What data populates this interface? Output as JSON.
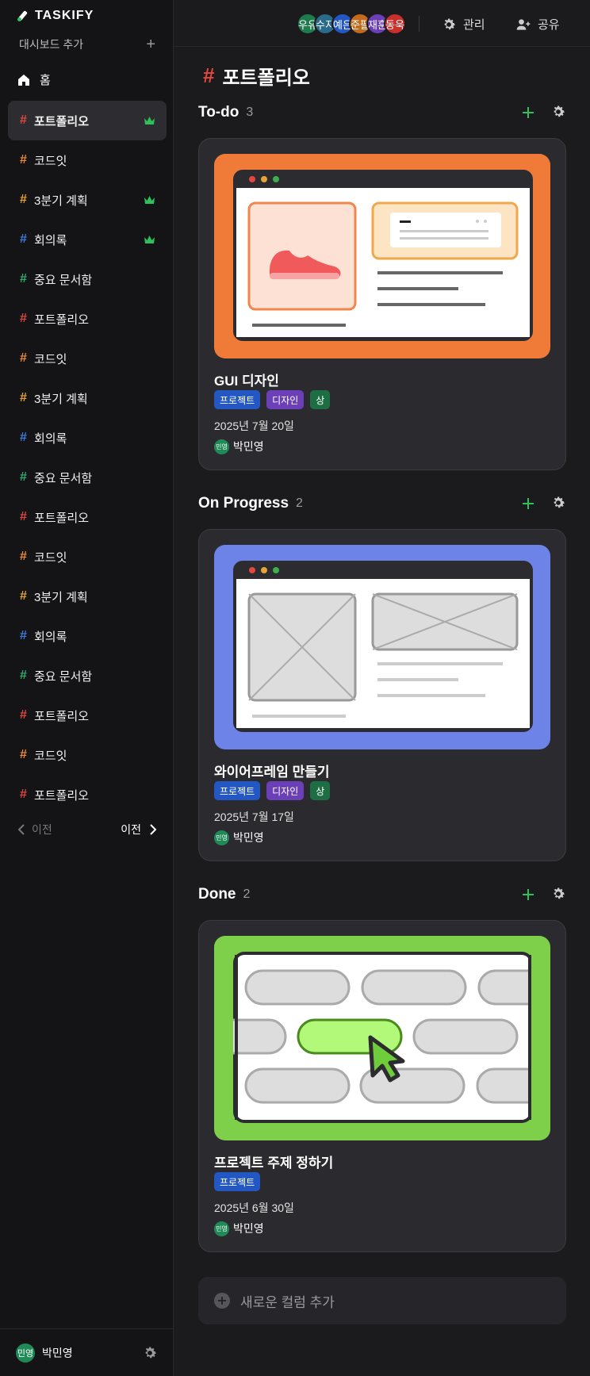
{
  "brand": {
    "name": "TASKIFY",
    "accent": "#2ec05a"
  },
  "sidebar": {
    "add_dashboard_label": "대시보드 추가",
    "add_dashboard_icon": "plus-icon",
    "home_label": "홈",
    "boards": [
      {
        "label": "포트폴리오",
        "color": "#e2483d",
        "owner": true,
        "active": true
      },
      {
        "label": "코드잇",
        "color": "#ee8a3a",
        "owner": false,
        "active": false
      },
      {
        "label": "3분기 계획",
        "color": "#e8a338",
        "owner": true,
        "active": false
      },
      {
        "label": "회의록",
        "color": "#3d7de0",
        "owner": true,
        "active": false
      },
      {
        "label": "중요 문서함",
        "color": "#2fae6b",
        "owner": false,
        "active": false
      },
      {
        "label": "포트폴리오",
        "color": "#e2483d",
        "owner": false,
        "active": false
      },
      {
        "label": "코드잇",
        "color": "#ee8a3a",
        "owner": false,
        "active": false
      },
      {
        "label": "3분기 계획",
        "color": "#e8a338",
        "owner": false,
        "active": false
      },
      {
        "label": "회의록",
        "color": "#3d7de0",
        "owner": false,
        "active": false
      },
      {
        "label": "중요 문서함",
        "color": "#2fae6b",
        "owner": false,
        "active": false
      },
      {
        "label": "포트폴리오",
        "color": "#e2483d",
        "owner": false,
        "active": false
      },
      {
        "label": "코드잇",
        "color": "#ee8a3a",
        "owner": false,
        "active": false
      },
      {
        "label": "3분기 계획",
        "color": "#e8a338",
        "owner": false,
        "active": false
      },
      {
        "label": "회의록",
        "color": "#3d7de0",
        "owner": false,
        "active": false
      },
      {
        "label": "중요 문서함",
        "color": "#2fae6b",
        "owner": false,
        "active": false
      },
      {
        "label": "포트폴리오",
        "color": "#e2483d",
        "owner": false,
        "active": false
      },
      {
        "label": "코드잇",
        "color": "#ee8a3a",
        "owner": false,
        "active": false
      },
      {
        "label": "포트폴리오",
        "color": "#e2483d",
        "owner": false,
        "active": false
      }
    ],
    "pager": {
      "prev_label": "이전",
      "next_label": "이전"
    },
    "user": {
      "initials": "민영",
      "name": "박민영"
    }
  },
  "topbar": {
    "members": [
      {
        "initials": "우유",
        "color": "#1f7a4d"
      },
      {
        "initials": "수지",
        "color": "#2a6b8a"
      },
      {
        "initials": "예은",
        "color": "#2357c4"
      },
      {
        "initials": "준팔",
        "color": "#c46a1c"
      },
      {
        "initials": "재훈",
        "color": "#6a3fb8"
      },
      {
        "initials": "동욱",
        "color": "#c9302c"
      }
    ],
    "manage_label": "관리",
    "share_label": "공유"
  },
  "page": {
    "title": "포트폴리오",
    "title_hash": "#"
  },
  "columns": [
    {
      "name": "To-do",
      "count": "3",
      "card": {
        "title": "GUI 디자인",
        "tags": [
          {
            "label": "프로젝트",
            "color": "blue"
          },
          {
            "label": "디자인",
            "color": "purple"
          },
          {
            "label": "상",
            "color": "green"
          }
        ],
        "date": "2025년 7월 20일",
        "assignee_initials": "민영",
        "assignee": "박민영",
        "thumb_color": "#f07b39",
        "thumb": "sneaker-illustration"
      }
    },
    {
      "name": "On Progress",
      "count": "2",
      "card": {
        "title": "와이어프레임 만들기",
        "tags": [
          {
            "label": "프로젝트",
            "color": "blue"
          },
          {
            "label": "디자인",
            "color": "purple"
          },
          {
            "label": "상",
            "color": "green"
          }
        ],
        "date": "2025년 7월 17일",
        "assignee_initials": "민영",
        "assignee": "박민영",
        "thumb_color": "#6d83e8",
        "thumb": "wireframe-illustration"
      }
    },
    {
      "name": "Done",
      "count": "2",
      "card": {
        "title": "프로젝트 주제 정하기",
        "tags": [
          {
            "label": "프로젝트",
            "color": "blue"
          }
        ],
        "date": "2025년 6월 30일",
        "assignee_initials": "민영",
        "assignee": "박민영",
        "thumb_color": "#7ed04a",
        "thumb": "pill-selection-illustration"
      }
    }
  ],
  "add_column_label": "새로운 컬럼 추가"
}
